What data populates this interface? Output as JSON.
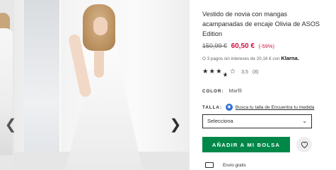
{
  "gallery": {
    "prev_icon": "chevron-left-icon",
    "next_icon": "chevron-right-icon"
  },
  "product": {
    "title": "Vestido de novia con mangas acampanadas de encaje Olivia de ASOS Edition",
    "old_price": "150,99 €",
    "new_price": "60,50 €",
    "discount": "(-59%)",
    "klarna_text": "O 3 pagos sin intereses de 20,16 € con",
    "klarna_brand": "Klarna.",
    "rating": {
      "value": 3.5,
      "value_text": "3,5",
      "count": "(8)"
    },
    "color_label": "COLOR:",
    "color_value": "Marfil",
    "size_label": "TALLA:",
    "size_link": "Busca tu talla de Encuentra tu medida",
    "size_select": "Selecciona",
    "add_button": "AÑADIR A MI BOLSA",
    "shipping_text": "Envío gratis"
  },
  "colors": {
    "price_red": "#d01345",
    "button_green": "#018849",
    "size_icon_blue": "#2d6fd6"
  }
}
